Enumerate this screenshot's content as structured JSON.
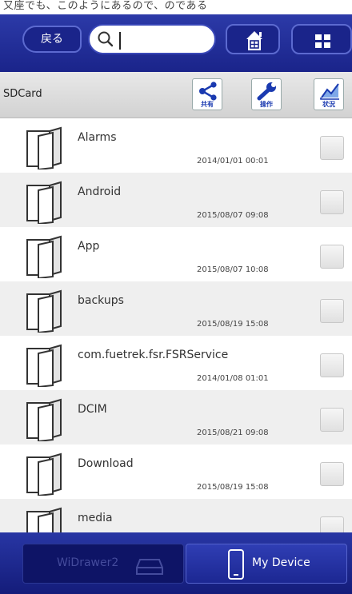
{
  "status_strip": "又座でも、このようにあるので、のである",
  "header": {
    "back_label": "戻る",
    "search_value": "",
    "home_icon": "home-icon",
    "grid_icon": "grid-icon"
  },
  "toolbar": {
    "path": "SDCard",
    "share_label": "共有",
    "ops_label": "操作",
    "status_label": "状況"
  },
  "files": [
    {
      "name": "Alarms",
      "date": "2014/01/01 00:01"
    },
    {
      "name": "Android",
      "date": "2015/08/07 09:08"
    },
    {
      "name": "App",
      "date": "2015/08/07 10:08"
    },
    {
      "name": "backups",
      "date": "2015/08/19 15:08"
    },
    {
      "name": "com.fuetrek.fsr.FSRService",
      "date": "2014/01/08 01:01"
    },
    {
      "name": "DCIM",
      "date": "2015/08/21 09:08"
    },
    {
      "name": "Download",
      "date": "2015/08/19 15:08"
    },
    {
      "name": "media",
      "date": ""
    }
  ],
  "bottom_tabs": {
    "widrawer_label": "WiDrawer2",
    "device_label": "My Device"
  },
  "colors": {
    "header_blue": "#1a248a",
    "accent": "#1a3ab0"
  }
}
